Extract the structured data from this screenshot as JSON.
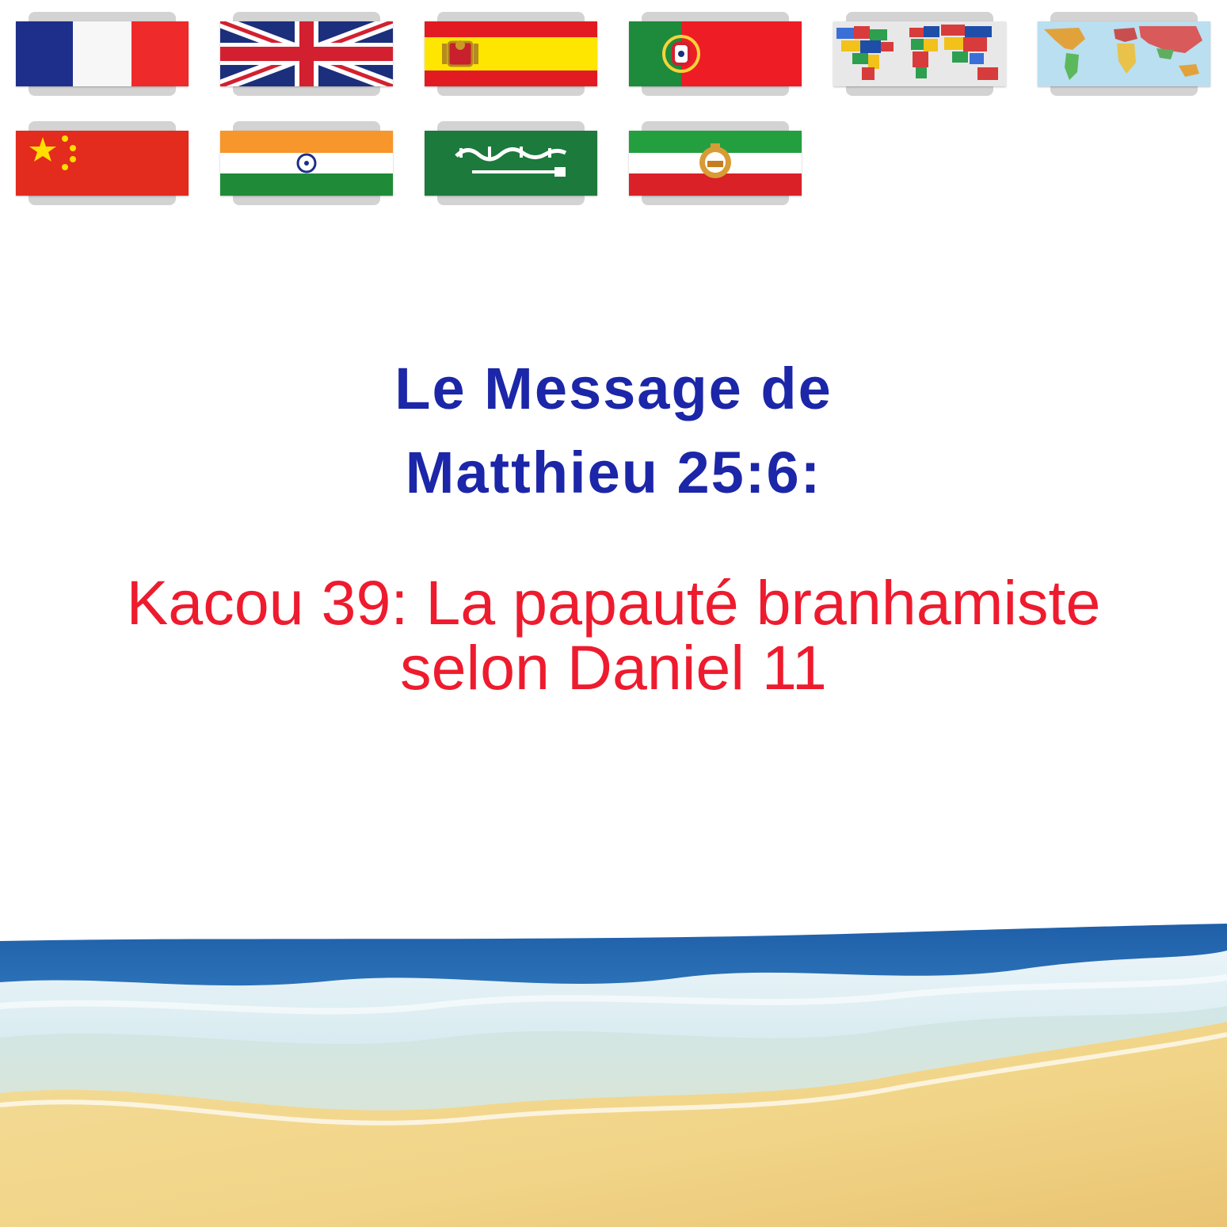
{
  "language_flags": [
    {
      "country": "France",
      "icon": "flag-france-icon"
    },
    {
      "country": "United Kingdom",
      "icon": "flag-uk-icon"
    },
    {
      "country": "Spain",
      "icon": "flag-spain-icon"
    },
    {
      "country": "Portugal",
      "icon": "flag-portugal-icon"
    },
    {
      "country": "World flags map",
      "icon": "world-flags-map-icon"
    },
    {
      "country": "World map",
      "icon": "world-map-icon"
    },
    {
      "country": "China",
      "icon": "flag-china-icon"
    },
    {
      "country": "India",
      "icon": "flag-india-icon"
    },
    {
      "country": "Saudi Arabia",
      "icon": "flag-saudi-arabia-icon"
    },
    {
      "country": "Iran",
      "icon": "flag-iran-icon"
    }
  ],
  "headline": {
    "line1": "Le Message de",
    "line2": "Matthieu 25:6:"
  },
  "subtitle": {
    "line1": "Kacou 39: La papauté branhamiste",
    "line2": "selon Daniel 11"
  },
  "colors": {
    "headline": "#1c26a8",
    "subtitle": "#ee1b2e",
    "tab": "#d3d3d3"
  },
  "background_scene": "beach-waves-image"
}
